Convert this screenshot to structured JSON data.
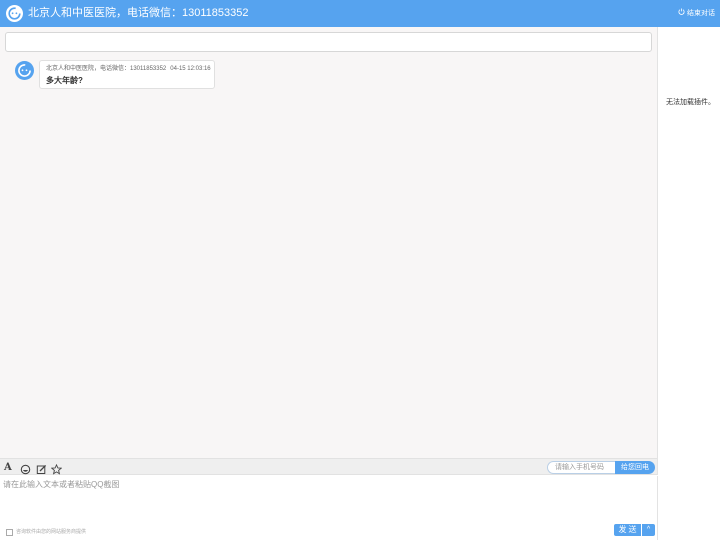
{
  "header": {
    "title": "北京人和中医医院，电话微信：13011853352",
    "end_chat_label": "结束对话"
  },
  "messages": [
    {
      "sender": "北京人和中医医院，电话微信：13011853352",
      "time": "04-15 12:03:16",
      "text": "多大年龄?"
    }
  ],
  "side_panel": {
    "plugin_message": "无法加载插件。"
  },
  "toolbar": {
    "font_icon_glyph": "A",
    "phone_placeholder": "请输入手机号码",
    "callback_label": "给您回电"
  },
  "composer": {
    "placeholder": "请在此输入文本或者粘贴QQ截图",
    "value": "",
    "send_label": "发送",
    "send_menu_glyph": "^",
    "footer_note": "咨询软件由您的网站服务商提供"
  },
  "colors": {
    "accent": "#56a3ef",
    "chat_bg": "#f8f6f6"
  }
}
